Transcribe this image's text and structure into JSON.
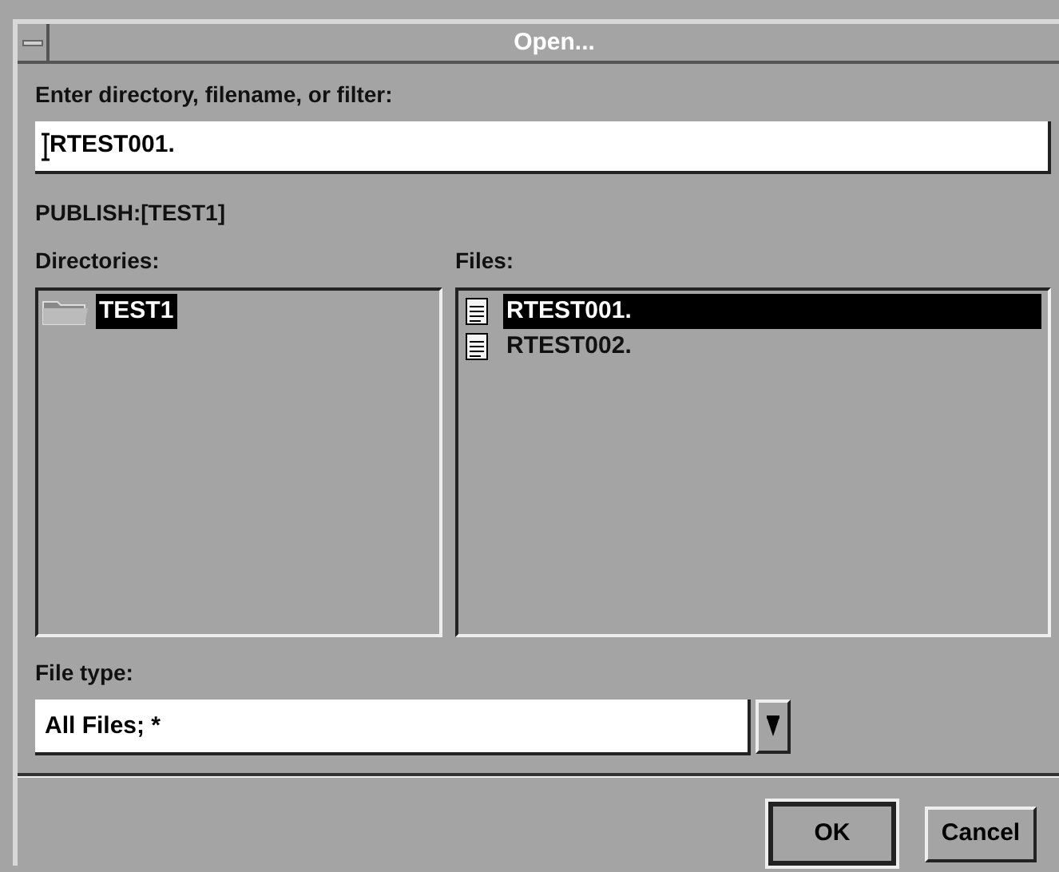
{
  "window": {
    "title": "Open..."
  },
  "filter": {
    "label": "Enter directory, filename, or filter:",
    "value": "RTEST001."
  },
  "current_path": "PUBLISH:[TEST1]",
  "directories": {
    "label": "Directories:",
    "items": [
      {
        "name": "TEST1",
        "selected": true
      }
    ]
  },
  "files": {
    "label": "Files:",
    "items": [
      {
        "name": "RTEST001.",
        "selected": true
      },
      {
        "name": "RTEST002.",
        "selected": false
      }
    ]
  },
  "file_type": {
    "label": "File type:",
    "value": "All Files; *"
  },
  "buttons": [
    {
      "label": "OK",
      "default": true
    },
    {
      "label": "Cancel",
      "default": false
    }
  ]
}
